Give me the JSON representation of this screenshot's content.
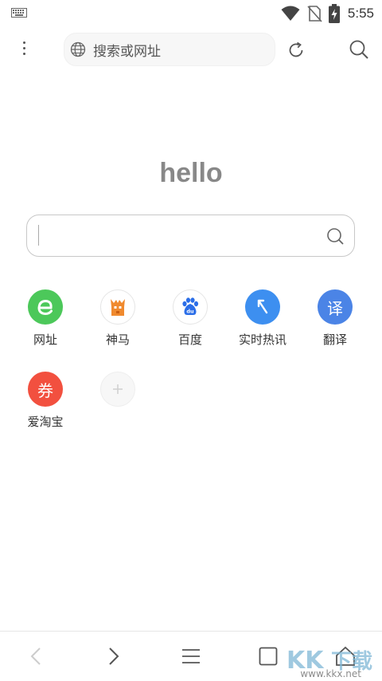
{
  "status_bar": {
    "time": "5:55",
    "icons": [
      "keyboard-icon",
      "wifi-icon",
      "no-sim-icon",
      "battery-charging-icon"
    ]
  },
  "toolbar": {
    "address_placeholder": "搜索或网址",
    "icons": [
      "more-menu-icon",
      "globe-icon",
      "refresh-icon",
      "search-icon"
    ]
  },
  "main": {
    "title": "hello",
    "search_value": ""
  },
  "shortcuts": [
    {
      "label": "网址",
      "icon": "e-browser-icon",
      "color": "#4cc85a"
    },
    {
      "label": "神马",
      "icon": "shenma-icon",
      "color": "#f08a2e"
    },
    {
      "label": "百度",
      "icon": "baidu-paw-icon",
      "color": "#2b6ee8"
    },
    {
      "label": "实时热讯",
      "icon": "news-arrow-icon",
      "color": "#3d8ff0"
    },
    {
      "label": "翻译",
      "icon": "translate-icon",
      "color": "#4b84e6",
      "glyph": "译"
    },
    {
      "label": "爱淘宝",
      "icon": "coupon-icon",
      "color": "#f2503f",
      "glyph": "券"
    },
    {
      "label": "",
      "icon": "add-icon",
      "color": "#f2f2f2"
    }
  ],
  "bottom_bar": {
    "icons": [
      "back-icon",
      "forward-icon",
      "menu-icon",
      "tabs-icon",
      "home-icon"
    ]
  },
  "watermark": {
    "text": "KK下载",
    "url": "www.kkx.net"
  }
}
